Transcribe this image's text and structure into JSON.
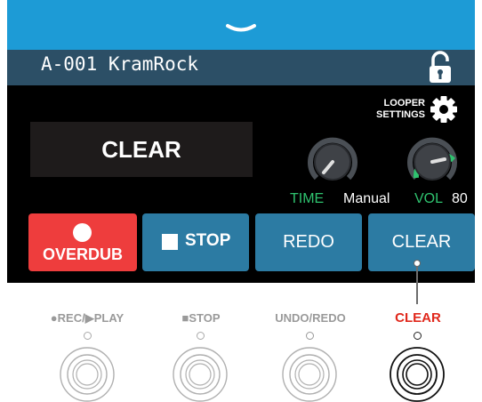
{
  "header": {
    "patch_name": "A-001 KramRock",
    "chevron_icon": "chevron-down-icon",
    "lock_icon": "lock-icon"
  },
  "settings": {
    "line1": "LOOPER",
    "line2": "SETTINGS",
    "icon": "gear-icon"
  },
  "display": {
    "text": "CLEAR"
  },
  "params": {
    "time": {
      "label": "TIME",
      "value": "Manual"
    },
    "vol": {
      "label": "VOL",
      "value": "80"
    }
  },
  "buttons": {
    "overdub": "OVERDUB",
    "stop": "STOP",
    "redo": "REDO",
    "clear": "CLEAR"
  },
  "pedals": [
    {
      "label": "●REC/▶PLAY",
      "active": false
    },
    {
      "label": "■STOP",
      "active": false
    },
    {
      "label": "UNDO/REDO",
      "active": false
    },
    {
      "label": "CLEAR",
      "active": true
    }
  ],
  "colors": {
    "topbar": "#1d9bd6",
    "titlebar": "#2c4f66",
    "overdub": "#ee3d3d",
    "button_blue": "#2c7ba3",
    "param_label_green": "#2fc26f",
    "active_pedal_red": "#e0281c"
  }
}
